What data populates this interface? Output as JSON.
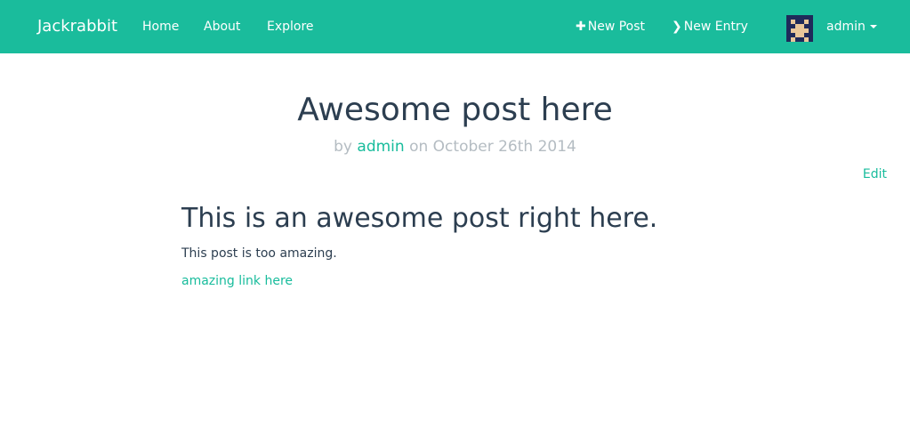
{
  "navbar": {
    "brand": "Jackrabbit",
    "links": {
      "home": "Home",
      "about": "About",
      "explore": "Explore"
    },
    "actions": {
      "new_post": "New Post",
      "new_entry": "New Entry"
    },
    "user": {
      "name": "admin",
      "avatar_icon": "pixel-avatar-icon"
    }
  },
  "post": {
    "title": "Awesome post here",
    "meta_by": "by",
    "author": "admin",
    "meta_on": "on October 26th 2014",
    "edit_label": "Edit",
    "heading": "This is an awesome post right here.",
    "paragraph": "This post is too amazing.",
    "link_text": "amazing link here"
  },
  "colors": {
    "brand": "#1abc9c",
    "link": "#18bc9c",
    "text": "#2c3e50",
    "muted": "#b4bcc2"
  }
}
